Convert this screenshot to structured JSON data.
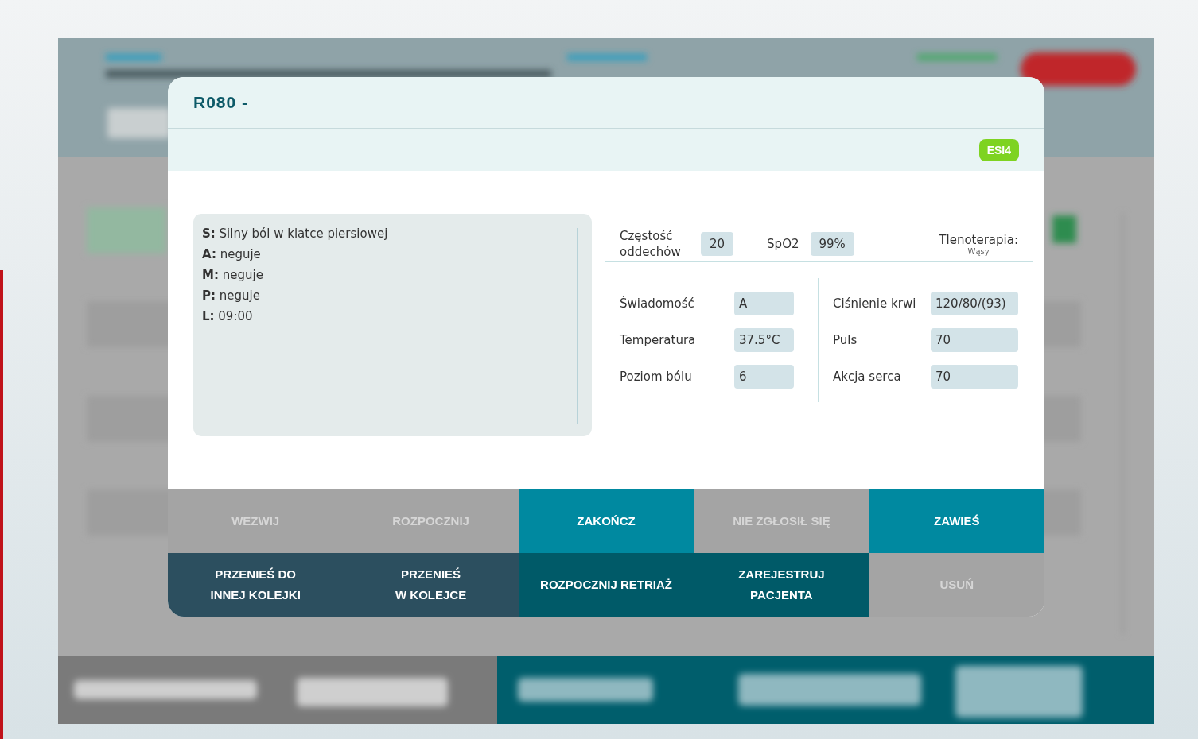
{
  "modal": {
    "title": "R080 -",
    "badge": "ESI4"
  },
  "sample": [
    "**S:** Silny ból w klatce piersiowej",
    "**A:** neguje",
    "**M:** neguje",
    "**P:** neguje",
    "**L:** 09:00"
  ],
  "top_vitals": [
    {
      "label": "Częstość oddechów",
      "value": "20"
    },
    {
      "label": "SpO2",
      "value": "99%"
    }
  ],
  "oxygen": {
    "label": "Tlenoterapia:",
    "value": "Wąsy"
  },
  "vitals_left": [
    {
      "label": "Świadomość",
      "value": "A"
    },
    {
      "label": "Temperatura",
      "value": "37.5°C"
    },
    {
      "label": "Poziom bólu",
      "value": "6"
    }
  ],
  "vitals_right": [
    {
      "label": "Ciśnienie krwi",
      "value": "120/80/(93)"
    },
    {
      "label": "Puls",
      "value": "70"
    },
    {
      "label": "Akcja serca",
      "value": "70"
    }
  ],
  "actions": [
    {
      "label": "WEZWIJ",
      "kind": "disabled"
    },
    {
      "label": "ROZPOCZNIJ",
      "kind": "disabled"
    },
    {
      "label": "ZAKOŃCZ",
      "kind": "accent"
    },
    {
      "label": "NIE ZGŁOSIŁ SIĘ",
      "kind": "disabled"
    },
    {
      "label": "ZAWIEŚ",
      "kind": "accent"
    },
    {
      "label": "PRZENIEŚ DO INNEJ KOLEJKI",
      "kind": "slate"
    },
    {
      "label": "PRZENIEŚ W KOLEJCE",
      "kind": "slate"
    },
    {
      "label": "ROZPOCZNIJ RETRIAŻ",
      "kind": "deep"
    },
    {
      "label": "ZAREJESTRUJ PACJENTA",
      "kind": "deep"
    },
    {
      "label": "USUŃ",
      "kind": "disabled"
    }
  ]
}
